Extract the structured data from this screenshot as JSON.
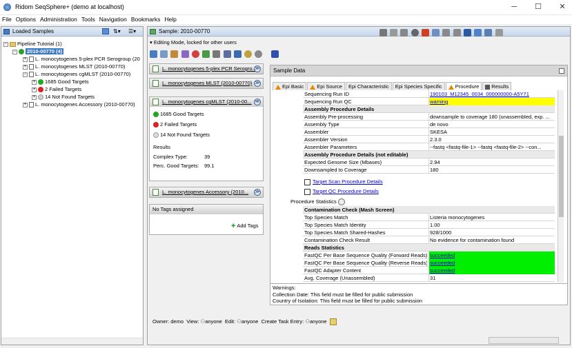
{
  "window": {
    "title": "Ridom SeqSphere+ (demo at localhost)",
    "minimize": "─",
    "maximize": "☐",
    "close": "✕"
  },
  "menu": [
    "File",
    "Options",
    "Administration",
    "Tools",
    "Navigation",
    "Bookmarks",
    "Help"
  ],
  "left": {
    "header": "Loaded Samples",
    "tree": {
      "pipeline": "Pipeline Tutorial (1)",
      "sample": "2010-00770 (4)",
      "items": [
        "L. monocytogenes 5-plex PCR Serogroup (20",
        "L. monocytogenes MLST (2010-00770)",
        "L. monocytogenes cgMLST (2010-00770)",
        "L. monocytogenes Accessory (2010-00770)"
      ],
      "sub": [
        "1685 Good Targets",
        "2 Failed Targets",
        "14 Not Found Targets"
      ]
    }
  },
  "main": {
    "header": "Sample: 2010-00770",
    "editing": "Editing Mode, locked for other users",
    "cards": {
      "serogroup": "L. monocytogenes 5-plex PCR Serogro...",
      "mlst": "L. monocytogenes MLST (2010-00770)",
      "cgmlst": "L. monocytogenes cgMLST (2010-00...",
      "good": "1685 Good Targets",
      "failed": "2 Failed Targets",
      "notfound": "14 Not Found Targets",
      "results_label": "Results",
      "complex_label": "Complex Type:",
      "complex_value": "39",
      "perc_label": "Perc. Good Targets:",
      "perc_value": "99.1",
      "accessory": "L. monocytogenes Accessory (2010...",
      "tags_title": "No Tags assigned",
      "add_tags": "Add Tags"
    },
    "sample_data": {
      "title": "Sample Data",
      "tabs": [
        "Epi Basic",
        "Epi Source",
        "Epi Characteristic",
        "Epi Species Specific",
        "Procedure",
        "Results"
      ],
      "rows": [
        {
          "k": "Sequencing Run ID",
          "v": "190103_M12345_0034_000000000-A5Y71",
          "style": "link"
        },
        {
          "k": "Sequencing Run QC",
          "v": "warning",
          "style": "yellow"
        },
        {
          "k": "Assembly Procedure Details",
          "v": "",
          "style": "header"
        },
        {
          "k": "Assembly Pre-processing",
          "v": "downsample to coverage 180 (unassembled, exp. ...",
          "style": ""
        },
        {
          "k": "Assembly Type",
          "v": "de novo",
          "style": ""
        },
        {
          "k": "Assembler",
          "v": "SKESA",
          "style": ""
        },
        {
          "k": "Assembler Version",
          "v": "2.3.0",
          "style": ""
        },
        {
          "k": "Assembler Parameters",
          "v": "--fastq <fastq-file-1> --fastq <fastq-file-2> --con...",
          "style": ""
        },
        {
          "k": "Assembly Procedure Details (not editable)",
          "v": "",
          "style": "header"
        },
        {
          "k": "Expected Genome Size (Mbases)",
          "v": "2.94",
          "style": ""
        },
        {
          "k": "Downsampled to Coverage",
          "v": "180",
          "style": ""
        }
      ],
      "links": [
        "Target Scan Procedure Details",
        "Target QC Procedure Details"
      ],
      "stats_label": "Procedure Statistics",
      "rows2": [
        {
          "k": "Contamination Check (Mash Screen)",
          "v": "",
          "style": "header"
        },
        {
          "k": "Top Species Match",
          "v": "Listeria monocytogenes",
          "style": ""
        },
        {
          "k": "Top Species Match Identity",
          "v": "1.00",
          "style": ""
        },
        {
          "k": "Top Species Match Shared-Hashes",
          "v": "928/1000",
          "style": ""
        },
        {
          "k": "Contamination Check Result",
          "v": "No evidence for contamination found",
          "style": ""
        },
        {
          "k": "Reads Statistics",
          "v": "",
          "style": "header"
        },
        {
          "k": "FastQC Per Base Sequence Quality (Forward Reads)",
          "v": "succeeded",
          "style": "green"
        },
        {
          "k": "FastQC Per Base Sequence Quality (Reverse Reads)",
          "v": "succeeded",
          "style": "green"
        },
        {
          "k": "FastQC Adapter Content",
          "v": "succeeded",
          "style": "green"
        },
        {
          "k": "Avg. Coverage (Unassembled)",
          "v": "31",
          "style": ""
        }
      ]
    },
    "warnings": [
      "Warnings:",
      "Collection Date: This field must be filled for public submission",
      "Country of Isolation: This field must be filled for public submission"
    ],
    "footer": {
      "owner": "Owner: demo",
      "view": "View:",
      "view_val": "anyone",
      "edit": "Edit:",
      "edit_val": "anyone",
      "task": "Create Task Entry:",
      "task_val": "anyone"
    }
  },
  "colors": {
    "accent": "#3a78c8",
    "yellow": "#ffff00",
    "green": "#00ee00"
  }
}
